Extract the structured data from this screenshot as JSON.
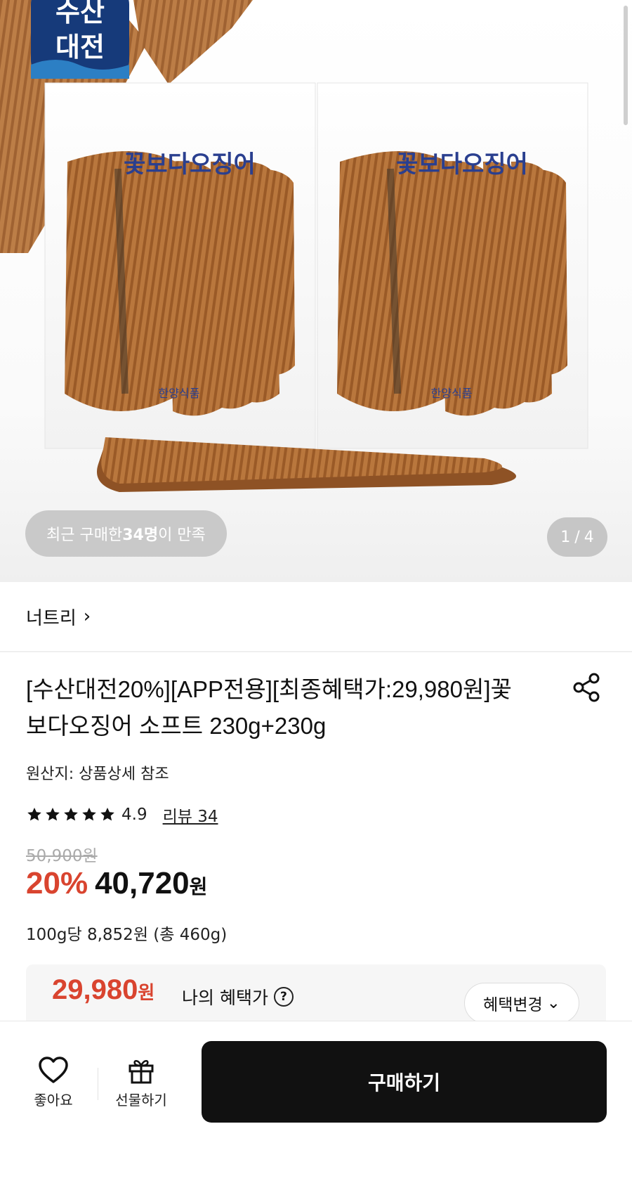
{
  "hero": {
    "logo_line1": "수산",
    "logo_line2": "대전",
    "package_brand": "꽃보다오징어",
    "package_maker": "한양식품",
    "badge_prefix": "최근 구매한 ",
    "badge_count": "34명",
    "badge_suffix": "이 만족",
    "page_current": "1",
    "page_separator": "/",
    "page_total": "4"
  },
  "brand": {
    "name": "너트리",
    "chevron": "›"
  },
  "product": {
    "title": "[수산대전20%][APP전용][최종혜택가:29,980원]꽃보다오징어 소프트 230g+230g",
    "origin": "원산지: 상품상세 참조",
    "rating": {
      "stars": 5,
      "value": "4.9",
      "review_label": "리뷰 34"
    },
    "original_price": "50,900원",
    "discount": "20%",
    "sale_price": "40,720",
    "won": "원",
    "unit_price": "100g당 8,852원 (총 460g)"
  },
  "benefit": {
    "price": "29,980",
    "won": "원",
    "label": "나의 혜택가",
    "help": "?",
    "change_label": "혜택변경",
    "change_chevron": "⌄"
  },
  "bottom_bar": {
    "like_label": "좋아요",
    "gift_label": "선물하기",
    "buy_label": "구매하기"
  },
  "colors": {
    "accent_red": "#d9442f",
    "buy_button": "#111111",
    "badge_bg": "#c9c9c9",
    "logo_bg": "#163a7a"
  }
}
